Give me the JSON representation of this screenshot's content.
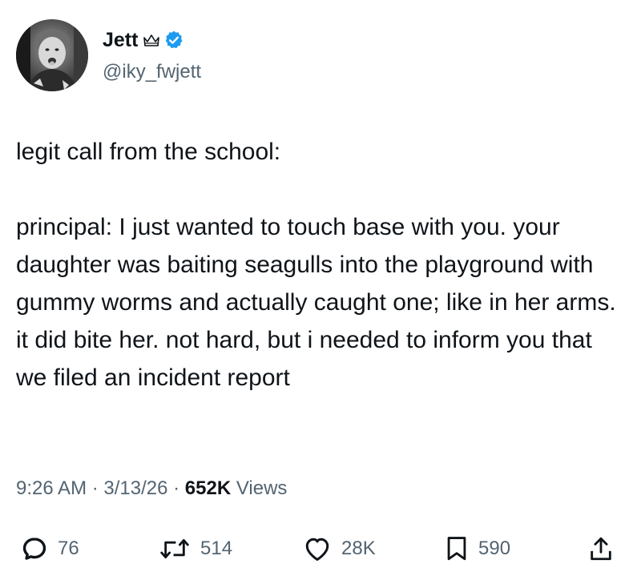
{
  "author": {
    "display_name": "Jett",
    "handle": "@iky_fwjett",
    "badges": [
      "crown-icon",
      "verified-icon"
    ],
    "verified_color": "#1d9bf0"
  },
  "tweet": {
    "paragraphs": [
      "legit call from the school:",
      "principal: I just wanted to touch base with you. your  daughter was baiting seagulls into the playground with gummy worms and actually caught one; like in her arms. it did bite her. not hard, but i needed to inform you that we filed an incident report"
    ]
  },
  "meta": {
    "time": "9:26 AM",
    "separator": " · ",
    "date": "3/13/26",
    "views_count": "652K",
    "views_label": " Views"
  },
  "actions": {
    "reply": {
      "icon": "reply-icon",
      "count": "76"
    },
    "retweet": {
      "icon": "retweet-icon",
      "count": "514"
    },
    "like": {
      "icon": "heart-icon",
      "count": "28K"
    },
    "bookmark": {
      "icon": "bookmark-icon",
      "count": "590"
    },
    "share": {
      "icon": "share-icon"
    }
  },
  "colors": {
    "text": "#0f1419",
    "secondary": "#536471",
    "background": "#ffffff"
  }
}
